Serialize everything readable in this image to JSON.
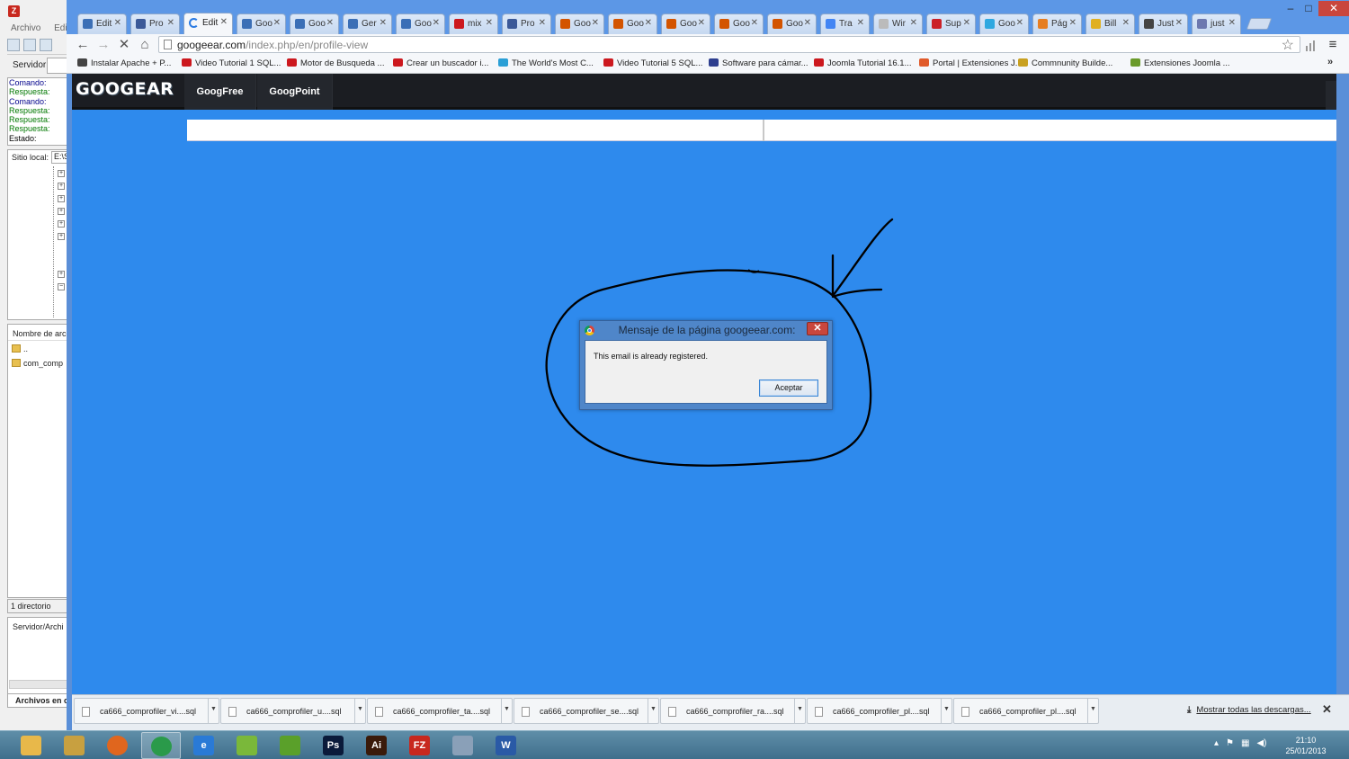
{
  "filezilla": {
    "menu": [
      "Archivo",
      "Edic"
    ],
    "server_label": "Servidor:",
    "log": [
      {
        "kind": "cmd",
        "text": "Comando:"
      },
      {
        "kind": "rsp",
        "text": "Respuesta:"
      },
      {
        "kind": "cmd",
        "text": "Comando:"
      },
      {
        "kind": "rsp",
        "text": "Respuesta:"
      },
      {
        "kind": "rsp",
        "text": "Respuesta:"
      },
      {
        "kind": "rsp",
        "text": "Respuesta:"
      },
      {
        "kind": "st",
        "text": "Estado:"
      }
    ],
    "local_site_label": "Sitio local:",
    "local_site_value": "E:\\S",
    "files_header": "Nombre de arc",
    "files": [
      "..",
      "com_comp"
    ],
    "dir_count": "1 directorio",
    "queue_header": "Servidor/Archi",
    "queue_tab": "Archivos en c"
  },
  "browser": {
    "tabs": [
      {
        "title": "Edit",
        "icon": "joomla-icon",
        "color": "#3b6fb6"
      },
      {
        "title": "Pro",
        "icon": "facebook-icon",
        "color": "#3b5998"
      },
      {
        "title": "Edit",
        "icon": "loading-icon",
        "color": "#2a7ae2",
        "active": true
      },
      {
        "title": "Goo",
        "icon": "joomla-icon",
        "color": "#3b6fb6"
      },
      {
        "title": "Goo",
        "icon": "joomla-icon",
        "color": "#3b6fb6"
      },
      {
        "title": "Ger",
        "icon": "joomla-icon",
        "color": "#3b6fb6"
      },
      {
        "title": "Goo",
        "icon": "joomla-icon",
        "color": "#3b6fb6"
      },
      {
        "title": "mix",
        "icon": "youtube-icon",
        "color": "#cc181e"
      },
      {
        "title": "Pro",
        "icon": "facebook-icon",
        "color": "#3b5998"
      },
      {
        "title": "Goo",
        "icon": "joomla-x-icon",
        "color": "#d35400"
      },
      {
        "title": "Goo",
        "icon": "joomla-x-icon",
        "color": "#d35400"
      },
      {
        "title": "Goo",
        "icon": "joomla-x-icon",
        "color": "#d35400"
      },
      {
        "title": "Goo",
        "icon": "joomla-x-icon",
        "color": "#d35400"
      },
      {
        "title": "Goo",
        "icon": "joomla-x-icon",
        "color": "#d35400"
      },
      {
        "title": "Tra",
        "icon": "translate-icon",
        "color": "#4285f4"
      },
      {
        "title": "Wir",
        "icon": "page-icon",
        "color": "#bbbbbb"
      },
      {
        "title": "Sup",
        "icon": "pinterest-icon",
        "color": "#cb2027"
      },
      {
        "title": "Goo",
        "icon": "twitter-icon",
        "color": "#2fa8e0"
      },
      {
        "title": "Pág",
        "icon": "folder-icon",
        "color": "#e67e22"
      },
      {
        "title": "Bill",
        "icon": "coins-icon",
        "color": "#e0b020"
      },
      {
        "title": "Just",
        "icon": "justgiving-icon",
        "color": "#444444"
      },
      {
        "title": "just",
        "icon": "pma-icon",
        "color": "#6c78af"
      }
    ],
    "url_host": "googeear.com",
    "url_path": "/index.php/en/profile-view",
    "bookmarks": [
      {
        "label": "Instalar Apache + P...",
        "color": "#444444"
      },
      {
        "label": "Video Tutorial 1 SQL...",
        "color": "#cc181e"
      },
      {
        "label": "Motor de Busqueda ...",
        "color": "#cc181e"
      },
      {
        "label": "Crear un buscador i...",
        "color": "#cc181e"
      },
      {
        "label": "The World's Most C...",
        "color": "#2a9fd6"
      },
      {
        "label": "Video Tutorial 5 SQL...",
        "color": "#cc181e"
      },
      {
        "label": "Software para cámar...",
        "color": "#2e3f8f"
      },
      {
        "label": "Joomla Tutorial 16.1...",
        "color": "#cc181e"
      },
      {
        "label": "Portal | Extensiones J...",
        "color": "#e05a2a"
      },
      {
        "label": "Commnunity Builde...",
        "color": "#c8a020"
      },
      {
        "label": "Extensiones Joomla ...",
        "color": "#6a9a2a"
      }
    ]
  },
  "site": {
    "logo": "GOOGEAR",
    "nav": [
      "GoogFree",
      "GoogPoint"
    ]
  },
  "alert": {
    "title": "Mensaje de la página googeear.com:",
    "message": "This email is already registered.",
    "ok_label": "Aceptar"
  },
  "downloads": {
    "items": [
      "ca666_comprofiler_vi....sql",
      "ca666_comprofiler_u....sql",
      "ca666_comprofiler_ta....sql",
      "ca666_comprofiler_se....sql",
      "ca666_comprofiler_ra....sql",
      "ca666_comprofiler_pl....sql",
      "ca666_comprofiler_pl....sql"
    ],
    "show_all": "Mostrar todas las descargas..."
  },
  "taskbar": {
    "apps": [
      {
        "name": "explorer",
        "label": "",
        "color": "#e8b84a"
      },
      {
        "name": "pidgin",
        "label": "",
        "color": "#c8a040"
      },
      {
        "name": "firefox",
        "label": "",
        "color": "#e0661e"
      },
      {
        "name": "chrome",
        "label": "",
        "color": "#2a9a4a",
        "active": true
      },
      {
        "name": "internet-explorer",
        "label": "e",
        "color": "#2a7ad6"
      },
      {
        "name": "app-green-1",
        "label": "",
        "color": "#7ab83a"
      },
      {
        "name": "app-green-2",
        "label": "",
        "color": "#5aa02a"
      },
      {
        "name": "photoshop",
        "label": "Ps",
        "color": "#0a1a3a"
      },
      {
        "name": "illustrator",
        "label": "Ai",
        "color": "#3a1a0a"
      },
      {
        "name": "filezilla",
        "label": "FZ",
        "color": "#c8281e"
      },
      {
        "name": "calculator",
        "label": "",
        "color": "#8aa0b8"
      },
      {
        "name": "word",
        "label": "W",
        "color": "#2a5aa6"
      }
    ],
    "time": "21:10",
    "date": "25/01/2013"
  },
  "colors": {
    "page_bg": "#2e8aed",
    "nav_bg": "#1b1d22",
    "alert_frame": "#4f86c9"
  }
}
